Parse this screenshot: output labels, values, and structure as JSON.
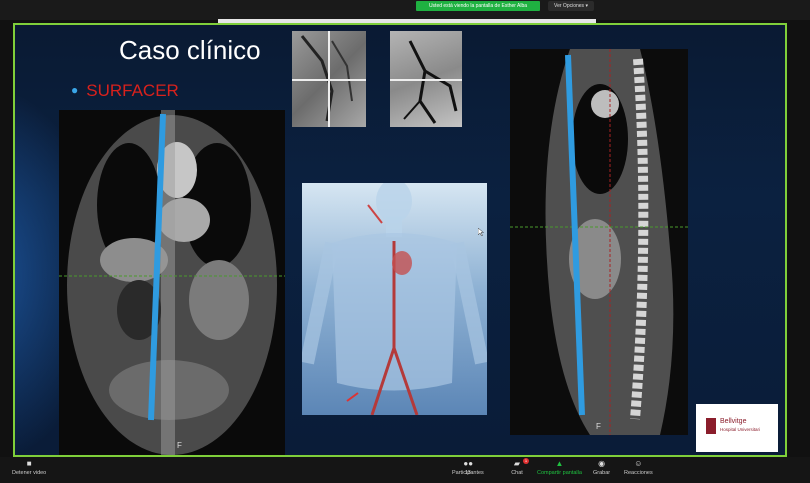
{
  "topbar": {
    "share_banner": "Usted está viendo la pantalla de Esther Alba",
    "view_options": "Ver Opciones"
  },
  "slide": {
    "title": "Caso clínico",
    "bullet": "SURFACER",
    "coronal_marker": "F",
    "sagittal_marker": "F",
    "logo_line1": "Bellvitge",
    "logo_line2": "Hospital Universitari"
  },
  "toolbar": {
    "items": [
      {
        "label": "Detener video",
        "icon": "video-camera-icon"
      },
      {
        "label": "Participantes",
        "icon": "participants-icon",
        "count": "13"
      },
      {
        "label": "Chat",
        "icon": "chat-icon",
        "badge": "1"
      },
      {
        "label": "Compartir pantalla",
        "icon": "share-screen-icon"
      },
      {
        "label": "Grabar",
        "icon": "record-icon"
      },
      {
        "label": "Reacciones",
        "icon": "reactions-icon"
      }
    ]
  },
  "colors": {
    "share_green": "#1fb141",
    "slide_border": "#7fcf3a",
    "bullet_red": "#d9211c",
    "marker_blue": "#2f9be0",
    "logo_maroon": "#8a1d2b"
  }
}
